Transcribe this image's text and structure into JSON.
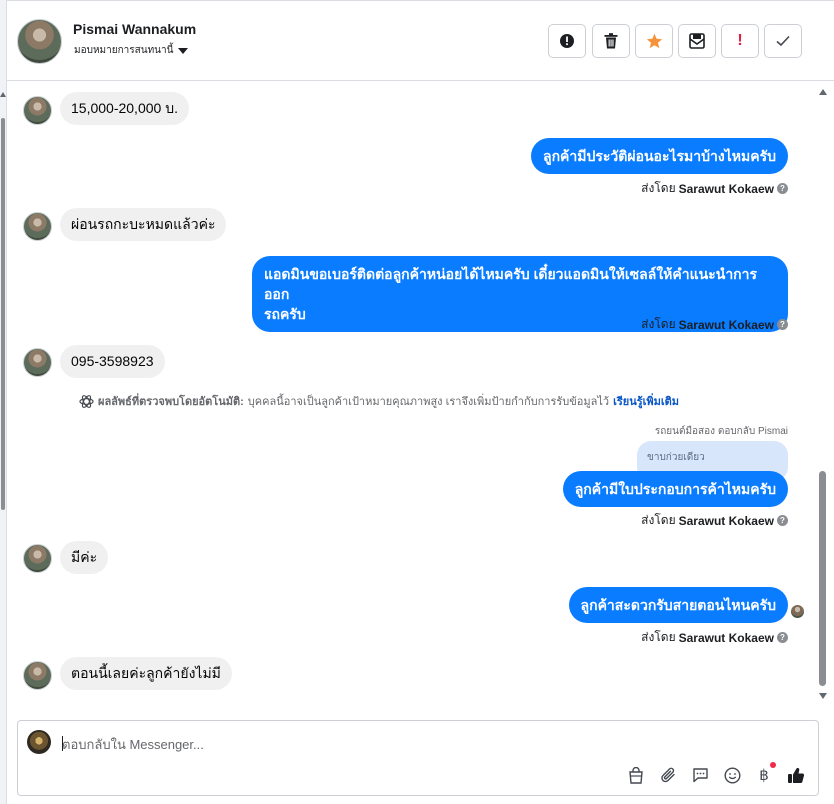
{
  "header": {
    "name": "Pismai Wannakum",
    "assign_label": "มอบหมายการสนทนานี้"
  },
  "toolbar": {
    "buttons": [
      "info-icon",
      "trash-icon",
      "star-icon",
      "mark-unread-icon",
      "spam-icon",
      "done-icon"
    ],
    "star_color": "#f7923a",
    "spam_color": "#e41e3f"
  },
  "messages": {
    "m1": "15,000-20,000 บ.",
    "m2": "ลูกค้ามีประวัติผ่อนอะไรมาบ้างไหมครับ",
    "m3": "ผ่อนรถกะบะหมดแล้วค่ะ",
    "m4_line1": "แอดมินขอเบอร์ติดต่อลูกค้าหน่อยได้ไหมครับ เดี๋ยวแอดมินให้เซลล์ให้คำแนะนำการออก",
    "m4_line2": "รถครับ",
    "m5": "095-3598923",
    "m6": "ลูกค้ามีใบประกอบการค้าไหมครับ",
    "m7": "มีค่ะ",
    "m8": "ลูกค้าสะดวกรับสายตอนไหนครับ",
    "m9": "ตอนนี้เลยค่ะลูกค้ายังไม่มี"
  },
  "sent_by": {
    "prefix": "ส่งโดย",
    "agent": "Sarawut Kokaew",
    "help": "?"
  },
  "auto_note": {
    "label": "ผลลัพธ์ที่ตรวจพบโดยอัตโนมัติ:",
    "text": "บุคคลนี้อาจเป็นลูกค้าเป้าหมายคุณภาพสูง เราจึงเพิ่มป้ายกำกับการรับข้อมูลไว้",
    "link": "เรียนรู้เพิ่มเติม"
  },
  "reply": {
    "meta": "รถยนต์มือสอง ตอบกลับ Pismai",
    "quote": "ขาบก่วยเดียว"
  },
  "composer": {
    "placeholder": "ตอบกลับใน Messenger...",
    "icons": [
      "shop-icon",
      "attachment-icon",
      "saved-reply-icon",
      "emoji-icon",
      "payment-icon",
      "like-icon"
    ],
    "baht": "฿"
  }
}
